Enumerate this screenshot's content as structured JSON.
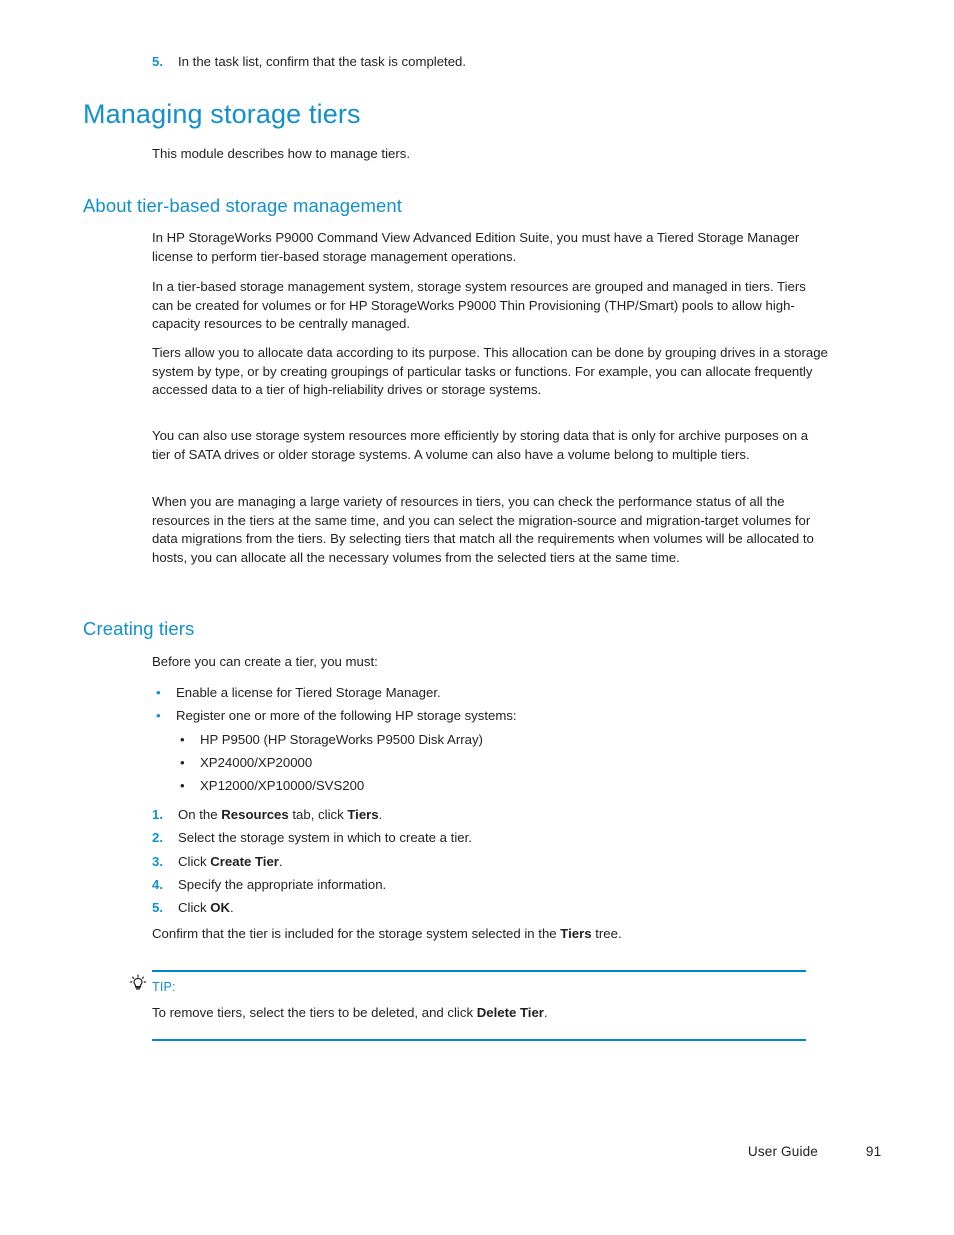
{
  "page": {
    "number": "91",
    "footer_label": "User Guide"
  },
  "top_step": {
    "number": "5.",
    "text": "In the task list, confirm that the task is completed."
  },
  "headings": {
    "h1_managing": "Managing storage tiers",
    "h2_about": "About tier-based storage management",
    "h2_creating": "Creating tiers"
  },
  "intro": {
    "module": "This module describes how to manage tiers."
  },
  "about_paragraphs": [
    "In HP StorageWorks P9000 Command View Advanced Edition Suite, you must have a Tiered Storage Manager license to perform tier-based storage management operations.",
    "In a tier-based storage management system, storage system resources are grouped and managed in tiers. Tiers can be created for volumes or for HP StorageWorks P9000 Thin Provisioning (THP/Smart) pools to allow high-capacity resources to be centrally managed.",
    "Tiers allow you to allocate data according to its purpose. This allocation can be done by grouping drives in a storage system by type, or by creating groupings of particular tasks or functions. For example, you can allocate frequently accessed data to a tier of high-reliability drives or storage systems.",
    "You can also use storage system resources more efficiently by storing data that is only for archive purposes on a tier of SATA drives or older storage systems. A volume can also have a volume belong to multiple tiers.",
    "When you are managing a large variety of resources in tiers, you can check the performance status of all the resources in the tiers at the same time, and you can select the migration-source and migration-target volumes for data migrations from the tiers. By selecting tiers that match all the requirements when volumes will be allocated to hosts, you can allocate all the necessary volumes from the selected tiers at the same time."
  ],
  "creating": {
    "before_text": "Before you can create a tier, you must:",
    "bullet_marker": "•",
    "prerequisites": [
      "Enable a license for Tiered Storage Manager.",
      "Register one or more of the following HP storage systems:"
    ],
    "storage_systems": [
      "HP P9500 (HP StorageWorks P9500 Disk Array)",
      "XP24000/XP20000",
      "XP12000/XP10000/SVS200"
    ],
    "steps": [
      {
        "number": "1.",
        "parts": [
          {
            "t": "On the ",
            "bold": false
          },
          {
            "t": "Resources",
            "bold": true
          },
          {
            "t": " tab, click ",
            "bold": false
          },
          {
            "t": "Tiers",
            "bold": true
          },
          {
            "t": ".",
            "bold": false
          }
        ]
      },
      {
        "number": "2.",
        "parts": [
          {
            "t": "Select the storage system in which to create a tier.",
            "bold": false
          }
        ]
      },
      {
        "number": "3.",
        "parts": [
          {
            "t": "Click ",
            "bold": false
          },
          {
            "t": "Create Tier",
            "bold": true
          },
          {
            "t": ".",
            "bold": false
          }
        ]
      },
      {
        "number": "4.",
        "parts": [
          {
            "t": "Specify the appropriate information.",
            "bold": false
          }
        ]
      },
      {
        "number": "5.",
        "parts": [
          {
            "t": "Click ",
            "bold": false
          },
          {
            "t": "OK",
            "bold": true
          },
          {
            "t": ".",
            "bold": false
          }
        ]
      }
    ],
    "confirm_parts": [
      {
        "t": "Confirm that the tier is included for the storage system selected in the ",
        "bold": false
      },
      {
        "t": "Tiers",
        "bold": true
      },
      {
        "t": " tree.",
        "bold": false
      }
    ]
  },
  "tip": {
    "label": "TIP:",
    "icon": "lightbulb-icon",
    "body_parts": [
      {
        "t": "To remove tiers, select the tiers to be deleted, and click ",
        "bold": false
      },
      {
        "t": "Delete Tier",
        "bold": true
      },
      {
        "t": ".",
        "bold": false
      }
    ]
  },
  "colors": {
    "heading_blue": "#1290cd",
    "rule_blue": "#0084c6",
    "body_black": "#231f20"
  }
}
